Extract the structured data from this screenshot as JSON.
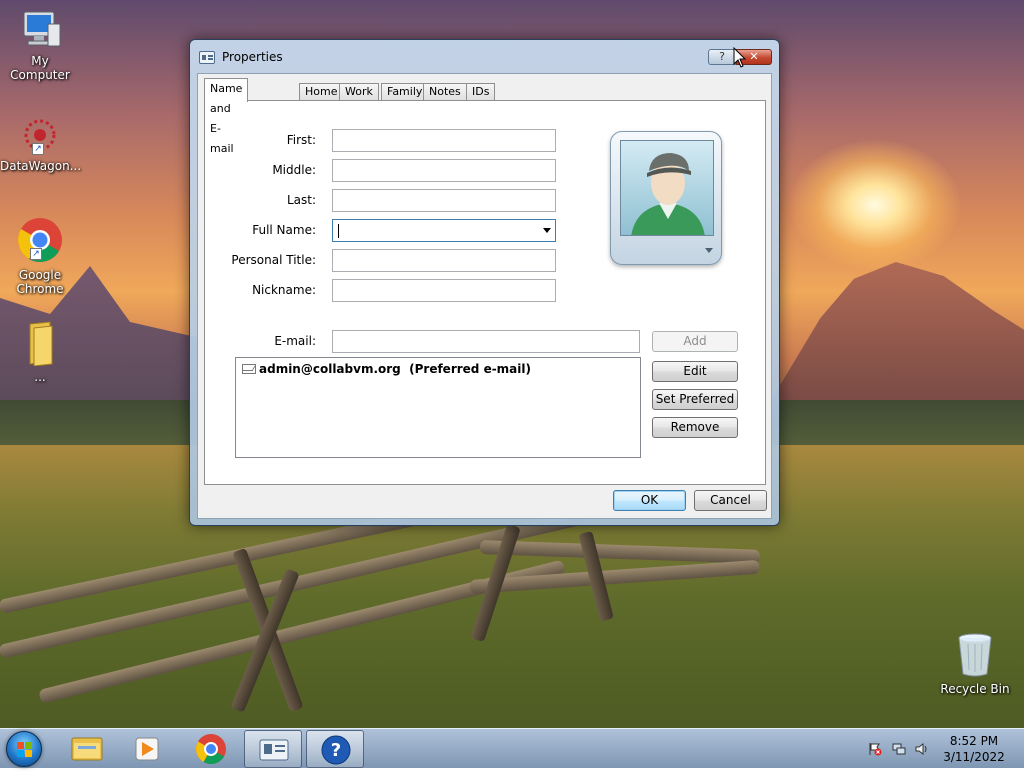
{
  "dialog": {
    "title": "Properties",
    "help_label": "?",
    "close_label": "✕",
    "tabs": [
      {
        "label": "Name and E-mail",
        "active": true
      },
      {
        "label": "Home"
      },
      {
        "label": "Work"
      },
      {
        "label": "Family"
      },
      {
        "label": "Notes"
      },
      {
        "label": "IDs"
      }
    ],
    "fields": {
      "first_label": "First:",
      "middle_label": "Middle:",
      "last_label": "Last:",
      "full_name_label": "Full Name:",
      "personal_title_label": "Personal Title:",
      "nickname_label": "Nickname:",
      "email_label": "E-mail:",
      "first_value": "",
      "middle_value": "",
      "last_value": "",
      "full_name_value": "",
      "personal_title_value": "",
      "nickname_value": "",
      "email_value": ""
    },
    "email_list": [
      {
        "address": "admin@collabvm.org",
        "note": "(Preferred e-mail)"
      }
    ],
    "buttons": {
      "add": "Add",
      "edit": "Edit",
      "set_preferred": "Set Preferred",
      "remove": "Remove",
      "ok": "OK",
      "cancel": "Cancel"
    }
  },
  "desktop_icons": [
    {
      "label": "My Computer",
      "icon": "computer-icon"
    },
    {
      "label": "DataWagon...",
      "icon": "datawagon-icon"
    },
    {
      "label": "Google Chrome",
      "icon": "chrome-icon"
    },
    {
      "label": "...",
      "icon": "folder-icon"
    },
    {
      "label": "Recycle Bin",
      "icon": "recycle-bin-icon"
    }
  ],
  "taskbar": {
    "items": [
      "file-explorer-icon",
      "media-player-icon",
      "chrome-icon",
      "contacts-icon",
      "help-icon"
    ],
    "clock_time": "8:52 PM",
    "clock_date": "3/11/2022"
  },
  "colors": {
    "chrome_red": "#db4437",
    "chrome_yellow": "#f4c20d",
    "chrome_green": "#0f9d58",
    "chrome_blue": "#4285f4",
    "close_red": "#c44a32"
  }
}
